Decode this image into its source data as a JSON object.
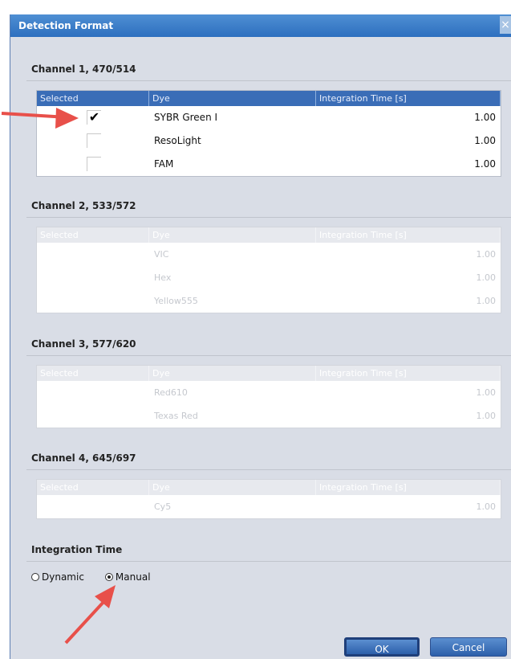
{
  "dialog": {
    "title": "Detection Format"
  },
  "columns": {
    "selected": "Selected",
    "dye": "Dye",
    "time": "Integration Time [s]"
  },
  "channels": [
    {
      "title": "Channel 1, 470/514",
      "rows": [
        {
          "checked": "✔",
          "dye": "SYBR Green I",
          "time": "1.00"
        },
        {
          "checked": "",
          "dye": "ResoLight",
          "time": "1.00"
        },
        {
          "checked": "",
          "dye": "FAM",
          "time": "1.00"
        }
      ]
    },
    {
      "title": "Channel 2, 533/572",
      "rows": [
        {
          "dye": "VIC",
          "time": "1.00"
        },
        {
          "dye": "Hex",
          "time": "1.00"
        },
        {
          "dye": "Yellow555",
          "time": "1.00"
        }
      ]
    },
    {
      "title": "Channel 3, 577/620",
      "rows": [
        {
          "dye": "Red610",
          "time": "1.00"
        },
        {
          "dye": "Texas Red",
          "time": "1.00"
        }
      ]
    },
    {
      "title": "Channel 4, 645/697",
      "rows": [
        {
          "dye": "Cy5",
          "time": "1.00"
        }
      ]
    }
  ],
  "integration": {
    "title": "Integration Time",
    "options": [
      "Dynamic",
      "Manual"
    ],
    "selected": "Manual"
  },
  "buttons": {
    "ok": "OK",
    "cancel": "Cancel"
  },
  "annotation": {
    "arrow_color": "#e8504a"
  }
}
